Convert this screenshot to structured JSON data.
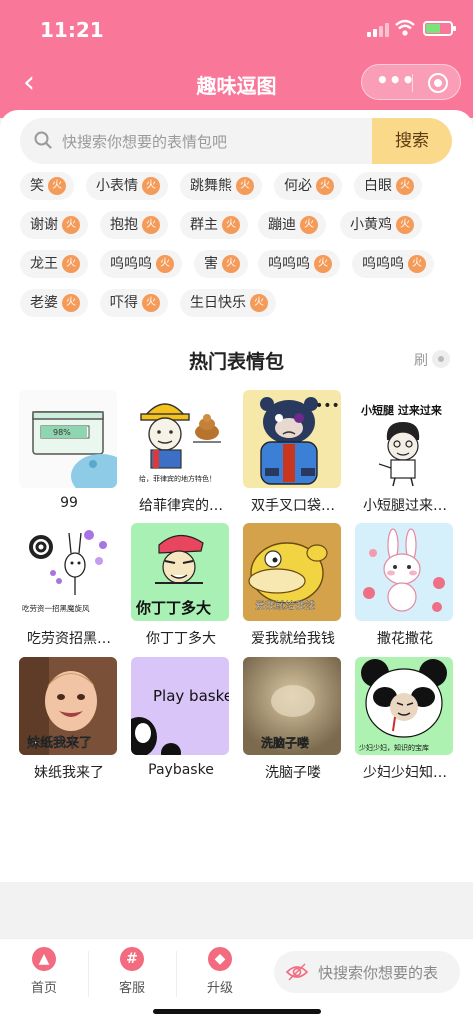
{
  "status": {
    "time": "11:21"
  },
  "nav": {
    "title": "趣味逗图"
  },
  "search": {
    "placeholder": "快搜索你想要的表情包吧",
    "button": "搜索"
  },
  "tags": [
    {
      "label": "笑"
    },
    {
      "label": "小表情"
    },
    {
      "label": "跳舞熊"
    },
    {
      "label": "何必"
    },
    {
      "label": "白眼"
    },
    {
      "label": "谢谢"
    },
    {
      "label": "抱抱"
    },
    {
      "label": "群主"
    },
    {
      "label": "蹦迪"
    },
    {
      "label": "小黄鸡"
    },
    {
      "label": "龙王"
    },
    {
      "label": "呜呜呜"
    },
    {
      "label": "害"
    },
    {
      "label": "呜呜呜"
    },
    {
      "label": "呜呜呜"
    },
    {
      "label": "老婆"
    },
    {
      "label": "吓得"
    },
    {
      "label": "生日快乐"
    }
  ],
  "tag_badge": "火",
  "section": {
    "title": "热门表情包",
    "refresh": "刷"
  },
  "stickers": [
    {
      "title": "99",
      "caption": "98%"
    },
    {
      "title": "给菲律宾的…",
      "caption": "给，菲律宾的地方特色！"
    },
    {
      "title": "双手叉口袋…",
      "caption": ""
    },
    {
      "title": "小短腿过来…",
      "caption": "小短腿 过来过来"
    },
    {
      "title": "吃劳资招黑…",
      "caption": "吃劳资一招黑魔旋风"
    },
    {
      "title": "你丁丁多大",
      "caption": "你丁丁多大"
    },
    {
      "title": "爱我就给我钱",
      "caption": "爱我就给我钱"
    },
    {
      "title": "撒花撒花",
      "caption": ""
    },
    {
      "title": "妹纸我来了",
      "caption": "妹纸我来了"
    },
    {
      "title": "Paybaske",
      "caption": "Play basketbal"
    },
    {
      "title": "洗脑子喽",
      "caption": "洗脑子喽"
    },
    {
      "title": "少妇少妇知…",
      "caption": "少妇少妇，知识的宝库"
    }
  ],
  "tabbar": {
    "home": "首页",
    "service": "客服",
    "upgrade": "升级",
    "search_placeholder": "快搜索你想要的表"
  },
  "colors": {
    "header": "#f9789a",
    "search_button": "#fbd98a",
    "fire_badge": "#f59b5a",
    "tab_icon": "#f26b7e"
  }
}
